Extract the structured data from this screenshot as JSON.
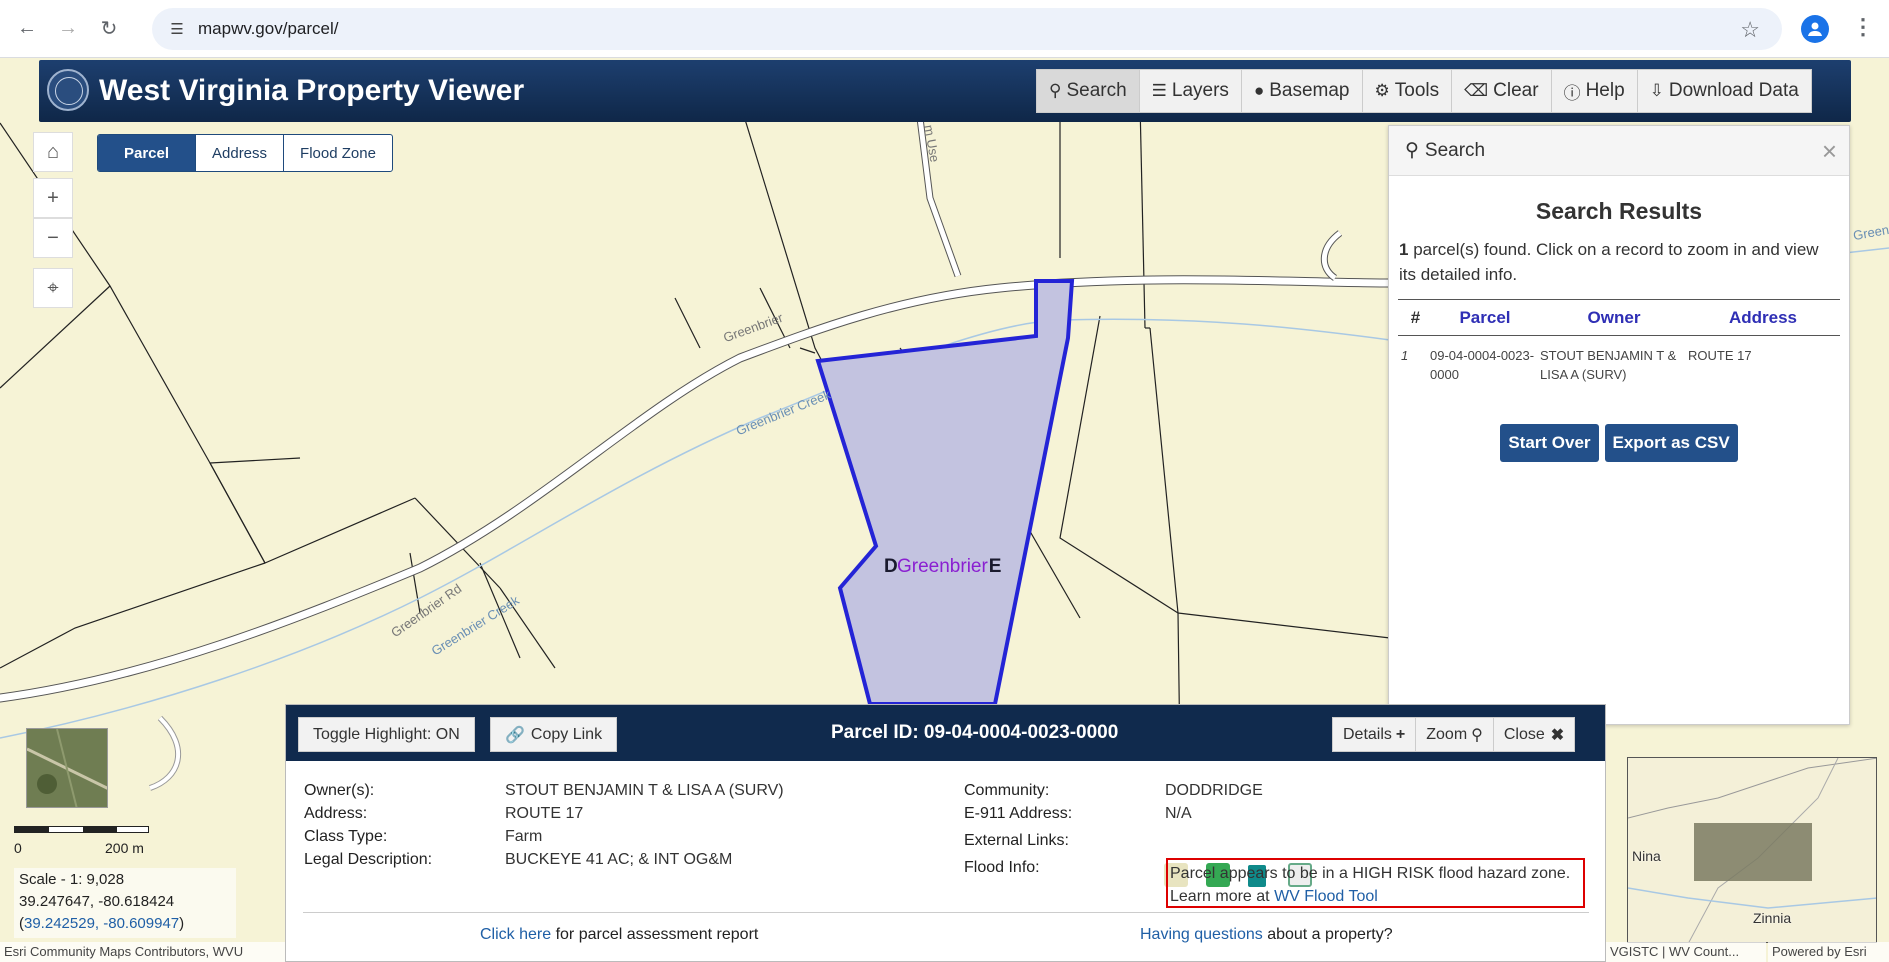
{
  "browser": {
    "url": "mapwv.gov/parcel/"
  },
  "app": {
    "title": "West Virginia Property Viewer"
  },
  "toolbar": {
    "items": [
      {
        "label": "Search",
        "icon": "search-icon"
      },
      {
        "label": "Layers",
        "icon": "list-icon"
      },
      {
        "label": "Basemap",
        "icon": "globe-icon"
      },
      {
        "label": "Tools",
        "icon": "gear-icon"
      },
      {
        "label": "Clear",
        "icon": "eraser-icon"
      },
      {
        "label": "Help",
        "icon": "help-icon"
      },
      {
        "label": "Download Data",
        "icon": "download-icon"
      }
    ]
  },
  "search_mode": {
    "tabs": [
      "Parcel",
      "Address",
      "Flood Zone"
    ],
    "active": "Parcel"
  },
  "search_panel": {
    "header": "Search",
    "title": "Search Results",
    "count": "1",
    "message": " parcel(s) found. Click on a record to zoom in and view its detailed info.",
    "columns": [
      "#",
      "Parcel",
      "Owner",
      "Address"
    ],
    "rows": [
      {
        "num": "1",
        "parcel": "09-04-0004-0023-0000",
        "owner": "STOUT BENJAMIN T & LISA A (SURV)",
        "address": "ROUTE 17"
      }
    ],
    "buttons": [
      "Start Over",
      "Export as CSV"
    ]
  },
  "info": {
    "toggle_highlight": "Toggle Highlight: ON",
    "copy_link": "Copy Link",
    "title": "Parcel ID: 09-04-0004-0023-0000",
    "actions": [
      "Details",
      "Zoom",
      "Close"
    ],
    "fields_left": [
      {
        "label": "Owner(s):",
        "value": "STOUT BENJAMIN T & LISA A (SURV)"
      },
      {
        "label": "Address:",
        "value": "ROUTE 17"
      },
      {
        "label": "Class Type:",
        "value": "Farm"
      },
      {
        "label": "Legal Description:",
        "value": "BUCKEYE 41 AC; & INT OG&M"
      }
    ],
    "fields_right": [
      {
        "label": "Community:",
        "value": "DODDRIDGE"
      },
      {
        "label": "E-911 Address:",
        "value": "N/A"
      },
      {
        "label": "External Links:",
        "value": ""
      },
      {
        "label": "Flood Info:",
        "value": ""
      }
    ],
    "flood_text": "Parcel appears to be in a HIGH RISK flood hazard zone.",
    "flood_learn": "Learn more at ",
    "flood_link": "WV Flood Tool",
    "footer_left_link": "Click here",
    "footer_left_text": " for parcel assessment report",
    "footer_right_link": "Having questions",
    "footer_right_text": " about a property?"
  },
  "map": {
    "parcel_label": "D",
    "parcel_label_end": "E",
    "creek_label": "Greenbrier",
    "road_label_1": "Greenbrier",
    "road_label_2": "Greenbrier Creek",
    "road_label_3": "Greenbrier Creek",
    "road_label_4": "Greenbrier Rd",
    "road_label_5": "m Use",
    "road_label_6": "Green",
    "scale_text": "Scale - 1: 9,028",
    "coords_1": "39.247647, -80.618424",
    "coords_2": "39.242529, -80.609947",
    "scale_0": "0",
    "scale_200": "200 m",
    "attribution_left": "Esri Community Maps Contributors, WVU",
    "attribution_right": "VGISTC | WV Count...",
    "powered_by": "Powered by Esri",
    "overview_labels": [
      "Nina",
      "Zinnia"
    ]
  },
  "colors": {
    "header_navy": "#102a4d",
    "parcel_outline": "#2424d6",
    "parcel_fill": "#c3c3e0",
    "flood_border": "#dd0000"
  }
}
